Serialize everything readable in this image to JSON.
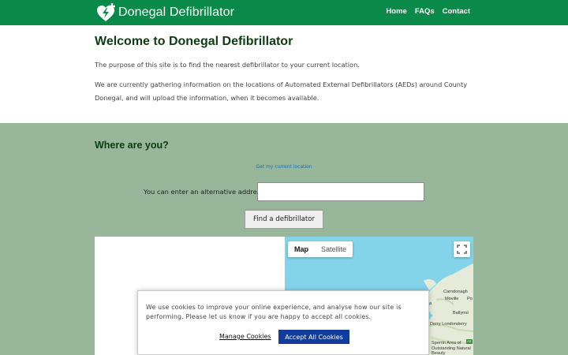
{
  "header": {
    "brand_name": "Donegal Defibrillator",
    "nav": [
      "Home",
      "FAQs",
      "Contact"
    ],
    "logo_icon": "heart-lightning-plus-icon",
    "bar_color": "#0a8a48"
  },
  "intro": {
    "title": "Welcome to Donegal Defibrillator",
    "paragraph_1": "The purpose of this site is to find the nearest defibrillator to your current location.",
    "paragraph_2": "We are currently gathering information on the locations of Automated External Defibrillators (AEDs) around County Donegal, and will upload the information, when it becomes available."
  },
  "locate": {
    "title": "Where are you?",
    "current_location_link": "Get my current location",
    "address_label": "You can enter an alternative address:",
    "address_value": "",
    "find_button": "Find a defibrillator",
    "section_color": "#98b699"
  },
  "map": {
    "map_tab": "Map",
    "satellite_tab": "Satellite",
    "active_tab": "Map",
    "fullscreen_icon": "fullscreen-icon",
    "place_labels": [
      "Carndonagh",
      "Moville",
      "Po",
      "Ballymo",
      "Derry Londonderry",
      "Sperrin Area of Outstanding Natural Beauty",
      "a",
      "A2"
    ]
  },
  "cookie_banner": {
    "message": "We use cookies to improve your online experience, and analyse how our site is performing. Please let us know if you are happy to accept all cookies.",
    "manage_label": "Manage Cookies",
    "accept_label": "Accept All Cookies",
    "accept_color": "#123c9c"
  }
}
